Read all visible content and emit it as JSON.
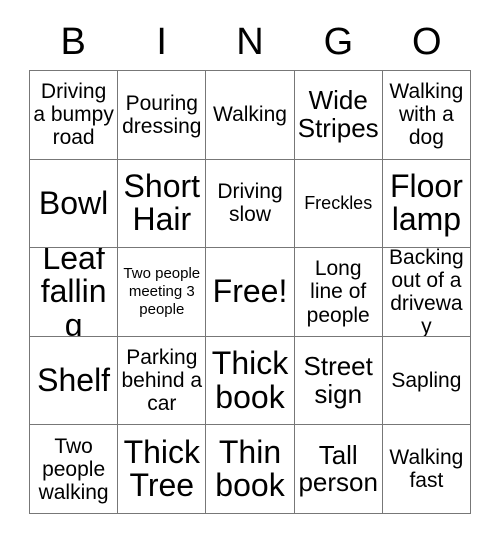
{
  "card": {
    "title": "BINGO",
    "header_letters": [
      "B",
      "I",
      "N",
      "G",
      "O"
    ],
    "free_space_label": "Free!",
    "grid_rows": 5,
    "grid_columns": 5,
    "colors": {
      "background": "#ffffff",
      "text": "#000000",
      "grid_line": "#777777"
    },
    "cells": [
      [
        {
          "text": "Driving a bumpy road",
          "size": "md"
        },
        {
          "text": "Pouring dressing",
          "size": "md"
        },
        {
          "text": "Walking",
          "size": "md"
        },
        {
          "text": "Wide Stripes",
          "size": "lg"
        },
        {
          "text": "Walking with a dog",
          "size": "md"
        }
      ],
      [
        {
          "text": "Bowl",
          "size": "xl"
        },
        {
          "text": "Short Hair",
          "size": "xl"
        },
        {
          "text": "Driving slow",
          "size": "md"
        },
        {
          "text": "Freckles",
          "size": "sm"
        },
        {
          "text": "Floor lamp",
          "size": "xl"
        }
      ],
      [
        {
          "text": "Leaf falling",
          "size": "xl"
        },
        {
          "text": "Two people meeting 3 people",
          "size": "xs"
        },
        {
          "text": "Free!",
          "size": "xl"
        },
        {
          "text": "Long line of people",
          "size": "md"
        },
        {
          "text": "Backing out of a driveway",
          "size": "md"
        }
      ],
      [
        {
          "text": "Shelf",
          "size": "xl"
        },
        {
          "text": "Parking behind a car",
          "size": "md"
        },
        {
          "text": "Thick book",
          "size": "xl"
        },
        {
          "text": "Street sign",
          "size": "lg"
        },
        {
          "text": "Sapling",
          "size": "md"
        }
      ],
      [
        {
          "text": "Two people walking",
          "size": "md"
        },
        {
          "text": "Thick Tree",
          "size": "xl"
        },
        {
          "text": "Thin book",
          "size": "xl"
        },
        {
          "text": "Tall person",
          "size": "lg"
        },
        {
          "text": "Walking fast",
          "size": "md"
        }
      ]
    ]
  }
}
